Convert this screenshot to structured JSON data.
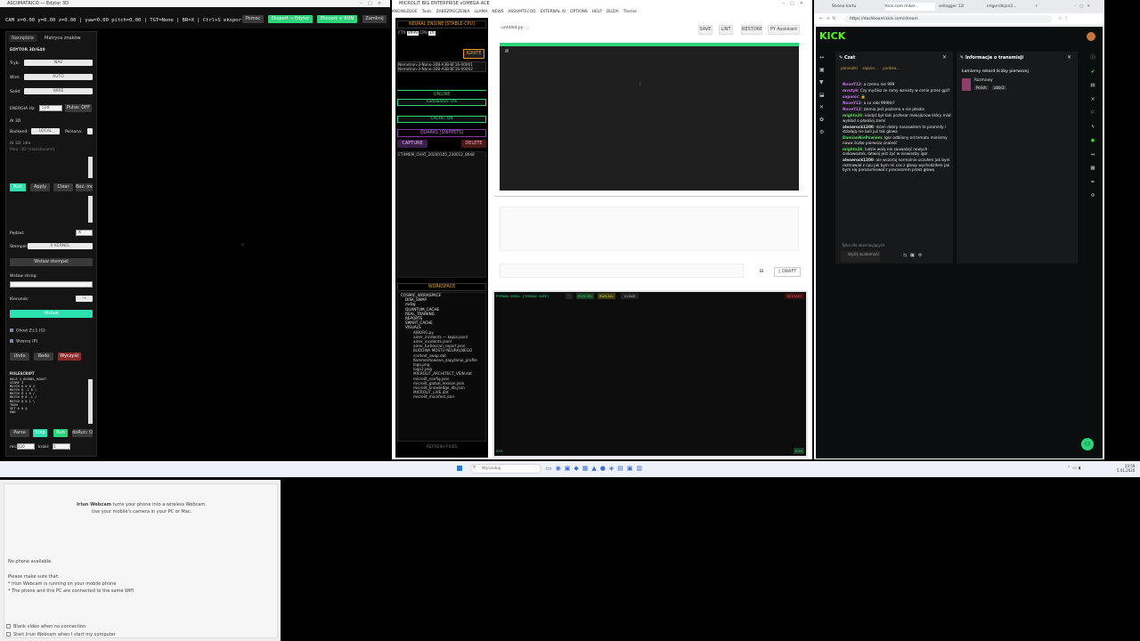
{
  "win1": {
    "title": "ASCIIMATRICO — Edytor 3D",
    "status": "CAM x=0.00 y=0.00 z=0.00 | yaw=0.00 pitch=0.00 | TGT=None | BR=X | Ctrl+S eksport",
    "buttons": {
      "help": "Pomoc",
      "export_editor": "Eksport → Edytor",
      "export_run": "Eksport + RUN",
      "close": "Zamknij"
    },
    "tabs": [
      "Narzędzia",
      "Matryca znaków"
    ],
    "panel": {
      "heading": "EDYTOR 3D/640",
      "tryb_label": "Tryb:",
      "tryb_value": "NAV",
      "wire_label": "Wire:",
      "wire_value": "AUTO",
      "solid_label": "Solid:",
      "solid_value": "WIRE",
      "energy_label": "ENERGIA Hz:",
      "energy_value": "528",
      "pulse": "Pulse: OFF",
      "ai_label": "AI 3D",
      "backend_label": "Backend:",
      "backend_value": "LOCAL",
      "persona_label": "Persona:",
      "ai_status": "AI 3D: idle",
      "ai_placeholder": "Polę: 3D (niezalecane)",
      "run": "Run",
      "apply": "Apply",
      "clear": "Clear",
      "mode": "Bez. mo",
      "pedzel_label": "Pędzel:",
      "pedzel_value": "X",
      "stempel_label": "Stempel:",
      "stempel_value": "X KERNEL",
      "insert_stamp": "Wstaw stempel",
      "string_label": "Wstaw string:",
      "direction_label": "Kierunek:",
      "direction_value": "→",
      "insert": "Wstaw",
      "ghost": "Ghost Z±1 (G)",
      "patterns": "Wzorce (P)",
      "undo": "Undo",
      "redo": "Redo",
      "clear_all": "Wyczyść",
      "rulescript_label": "RULESCRIPT",
      "rulescript": "RULE X_KERNEL_BOOST\nSCORE 3\nMATCH @ 0 0 X\nMATCH @ -1 0 \\\nMATCH @ 1 0 /\nMATCH @ 0 -1 /\nMATCH @ 0 1 \\\nTHEN\nSET 0 0 @\nEND",
      "parse": "Parse",
      "step": "Step",
      "run2": "Run",
      "reset": "doRun: O",
      "ms_label": "ms:",
      "ms_value": "120",
      "krok_label": "kroki:",
      "krok_value": "1"
    }
  },
  "win2": {
    "title": "MICROLIT BIG ENTERPRISE vOMEGA ACE",
    "menu": [
      "KNOWLEDGE",
      "Tools",
      "ZABEZPIECZENIA",
      "LLAMA",
      "NEWS",
      "ASSUMTECOD",
      "EXTERNAL AI",
      "OPTIONS",
      "HELP",
      "DUZAI",
      "Theme"
    ],
    "neural_header": "NEURAL ENGINE [STABLE-CPU]",
    "ctx_label": "CTX",
    "ctx_value": "8999",
    "cpu_label": "CPU",
    "cpu_value": "16",
    "ignite": "IGNITE",
    "models": [
      "Nemotron-3-Nano-30B-A3B-BF16-00001",
      "Nemotron-3-Nano-30B-A3B-BF16-00002"
    ],
    "online": "ONLINE",
    "loading": "Ładowanie: 0%",
    "cache": "CACHE: ON",
    "quarks": "QUARKS [SNIPPETS]",
    "capture": "CAPTURE",
    "delete": "DELETE",
    "snippet": "CTXMEM_CHAT_20260105_230012_8648",
    "workspace_header": "WORKSPACE",
    "tree": [
      "COSMIC_WORKSPACE",
      "DISK_SWAP",
      "mdzg",
      "QUANTUM_CACHE",
      "REAL_TRAINING",
      "REPORTS",
      "SMART_CACHE",
      "VISUALS",
      "AIBORG.py",
      "ainer_incidents — kopia.jsonl",
      "ainer_incidents.jsonl",
      "ainer_turboscan_report.json",
      "BUDOWA MOSTU NEURALNEGO",
      "context_swap.dat",
      "Kommentowane_zapytania_profile",
      "logo.png",
      "logo1.png",
      "MICROLIT_ARCHITECT_VEIN.dat",
      "microlit_config.json",
      "microlit_global_lexicon.json",
      "microlit_knowledge_db.json",
      "MICROLIT_LIVE.dat",
      "microlit_manifest.json"
    ],
    "refresh": "REFRESH FILES",
    "file_tab": "untitled.py",
    "top_buttons": [
      "SAVE",
      "LINT",
      "RESTORE",
      "PY Assistant"
    ],
    "draft": "DRAFT",
    "shell_label": "PYTHON SHELL [THREAD SAFE]",
    "shell_buttons": [
      "RUN SEL",
      "RUN ALL",
      "CLEAR"
    ],
    "restart": "RESTART",
    "prompt": ">>>",
    "run": "RUN"
  },
  "win3": {
    "tabs": [
      "Strona kartu",
      "Kick.com mikel...",
      "sellogger 12l",
      "imgur/dkjan2..."
    ],
    "url": "https://dashboard.kick.com/stream",
    "brand": "KICK",
    "chat_title": "Czat",
    "info_title": "Informacje o transmisji",
    "stream_title": "Łamiemy rekord liczby pierwszej",
    "category": "Rozmowy",
    "tags": [
      "Polish",
      "abbr2"
    ],
    "top_users": [
      "parasolki",
      "sapcio...",
      "yankee..."
    ],
    "messages": [
      {
        "u": "NoveY12",
        "t": "a czemu nie 999"
      },
      {
        "u": "mvstyk",
        "t": "Czy myślisz ze ramy wzrosty w cenie przez gpt?"
      },
      {
        "u": "saponic",
        "t": "🔒"
      },
      {
        "u": "NoveY12",
        "t": "a co robi 999Hz?"
      },
      {
        "u": "NoveY12",
        "t": "ziemia jest pozioma a nie płaska"
      },
      {
        "u": "mighta2k",
        "t": "kiedyś był taki profesor meksjkriow który miał wykład o płaskiej ziemi"
      },
      {
        "u": "alenerock1200",
        "t": "dzień dobry naszawiłem te piramidy i działają nie boli już tak głowa"
      },
      {
        "u": "DamianNiePowiem",
        "t": "Igor odbilony od tematu mielismy nowa liczbe pierwsza znaleść"
      },
      {
        "u": "mighta2k",
        "t": "ludzie wolą nie zauważać nowych ciekawostek, łatwiej jest żyć w niewiedzy igor"
      },
      {
        "u": "alenerock1200",
        "t": "ale wczoraj normalnie uczułem jak bym rozmawiał z cpu jak bym mi cos z głowy wychodziłem jak bym się porozumiewał z procesorem przez głowę"
      }
    ],
    "followers_only": "Tylko dla obserwujących",
    "send_placeholder": "Wyślij wiadomość",
    "count": "0"
  },
  "taskbar": {
    "search": "Wyszukaj",
    "time": "23:59",
    "date": "5.01.2026"
  },
  "iriun": {
    "title_bold": "Iriun Webcam",
    "title_rest": " turns your phone into a wireless Webcam.",
    "subtitle": "Use your mobile's camera in your PC or Mac.",
    "no_phone": "No phone available.",
    "make_sure": "Please make sure that:",
    "bullet1": "* Iriun Webcam is running on your mobile phone",
    "bullet2": "* The phone and this PC are connected to the same WiFi",
    "check1": "Blank video when no connection",
    "check2": "Start Iriun Webcam when I start my computer"
  }
}
